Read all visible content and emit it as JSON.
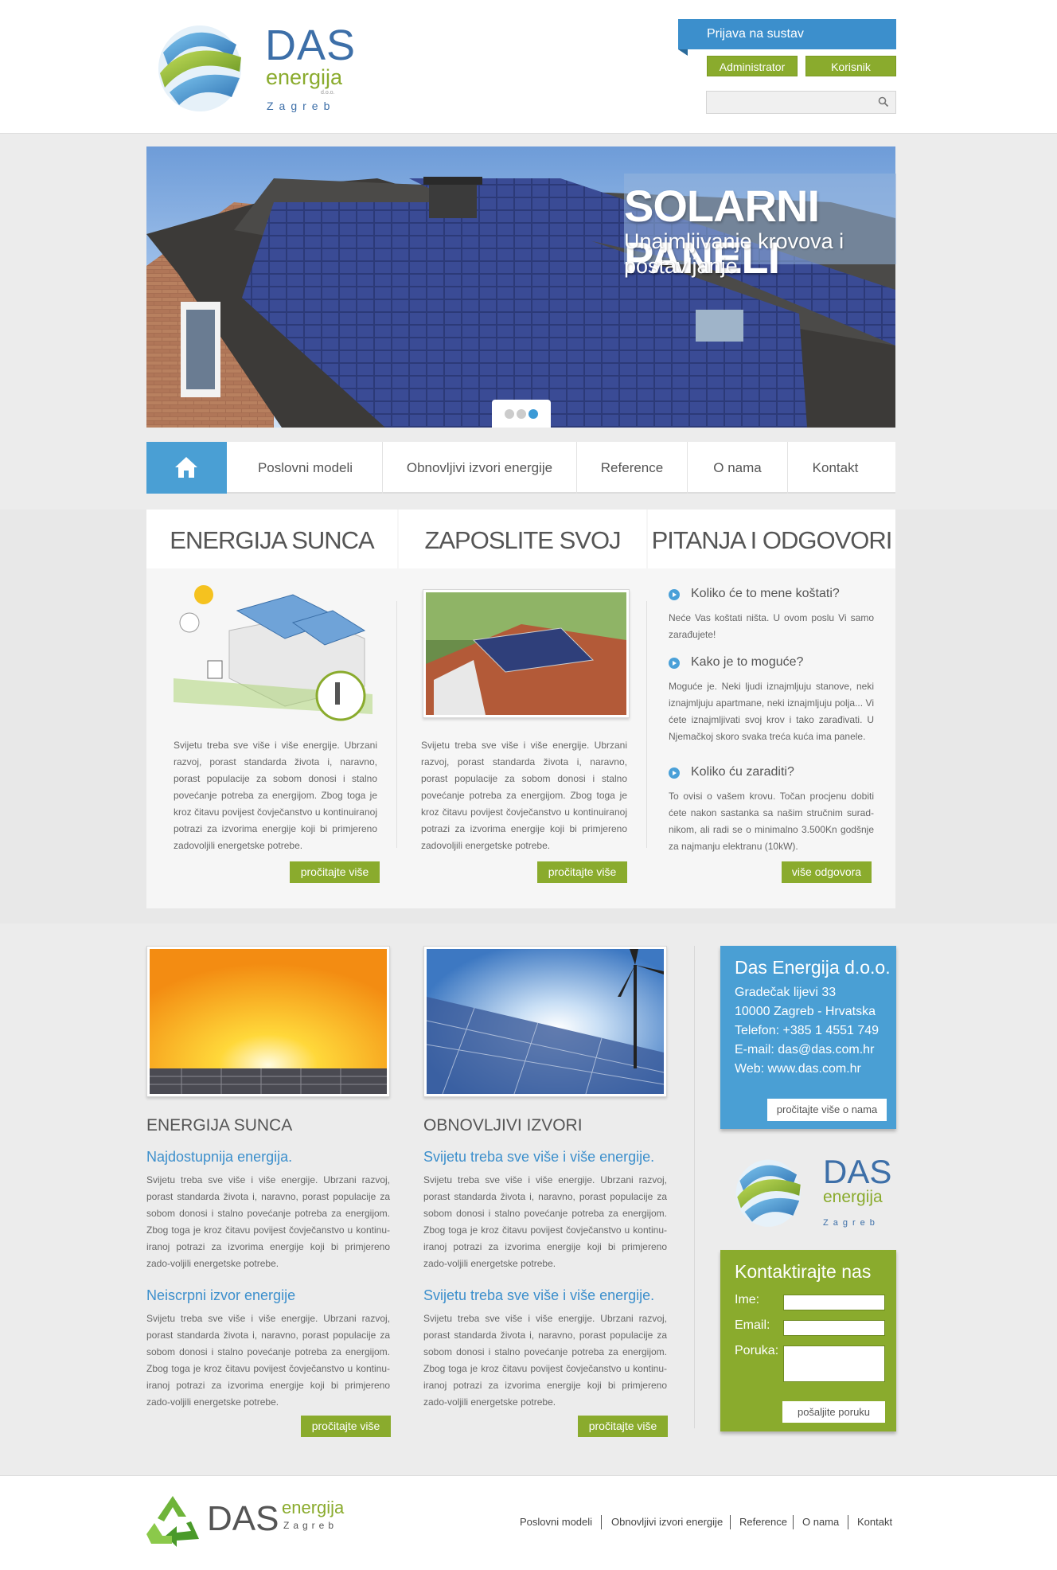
{
  "brand": {
    "name": "DAS",
    "sub": "energija",
    "suffix": "d.o.o.",
    "city": "Zagreb",
    "colors": {
      "blue": "#3c8fcc",
      "green": "#8aab2d"
    }
  },
  "login": {
    "tab": "Prijava na sustav",
    "admin_label": "Administrator",
    "user_label": "Korisnik",
    "search_placeholder": ""
  },
  "hero": {
    "title": "SOLARNI PANELI",
    "subtitle": "Unajmljivanje krovova i postavljanje",
    "active_slide": 3,
    "slide_count": 3
  },
  "nav": {
    "items": [
      "Poslovni modeli",
      "Obnovljivi izvori energije",
      "Reference",
      "O nama",
      "Kontakt"
    ]
  },
  "columns": [
    {
      "title": "ENERGIJA SUNCA",
      "text": "Svijetu treba sve više i više energije. Ubrzani razvoj, porast standarda života i, naravno, porast populacije za sobom donosi i stalno povećanje potreba za energijom. Zbog toga je kroz čitavu povijest čovječanstvo u kontinuiranoj potrazi za izvorima energije koji bi primjereno zadovoljili energetske potrebe.",
      "button": "pročitajte više"
    },
    {
      "title": "ZAPOSLITE SVOJ KROV",
      "text": "Svijetu treba sve više i više energije. Ubrzani razvoj, porast standarda života i, naravno, porast populacije za sobom donosi i stalno povećanje potreba za energijom. Zbog toga je kroz čitavu povijest čovječanstvo u kontinuiranoj potrazi za izvorima energije koji bi primjereno zadovoljili energetske potrebe.",
      "button": "pročitajte više"
    },
    {
      "title": "PITANJA I ODGOVORI",
      "button": "više odgovora",
      "faq": [
        {
          "q": "Koliko će to mene koštati?",
          "a": "Neće Vas koštati ništa. U ovom poslu Vi samo zarađujete!"
        },
        {
          "q": "Kako je to moguće?",
          "a": "Moguće je. Neki ljudi iznajmljuju stanove, neki iznajmljuju apartmane, neki iznajmljuju polja... Vi ćete iznajmljivati svoj krov i tako zarađivati. U Njemačkoj skoro svaka treća kuća ima panele."
        },
        {
          "q": "Koliko ću zaraditi?",
          "a": "To ovisi o vašem krovu. Točan procjenu dobiti ćete nakon sastanka sa našim stručnim surad-nikom, ali radi se o minimalno 3.500Kn godšnje za najmanju elektranu (10kW)."
        }
      ]
    }
  ],
  "articles": [
    {
      "title": "ENERGIJA SUNCA",
      "sub1": "Najdostupnija energija.",
      "text1": "Svijetu treba sve više i više energije. Ubrzani razvoj, porast standarda života i, naravno, porast populacije za sobom donosi i stalno povećanje potreba za energijom. Zbog toga je kroz čitavu povijest čovječanstvo u kontinu-iranoj potrazi za izvorima energije koji bi primjereno zado-voljili energetske potrebe.",
      "sub2": "Neiscrpni izvor energije",
      "text2": "Svijetu treba sve više i više energije. Ubrzani razvoj, porast standarda života i, naravno, porast populacije za sobom donosi i stalno povećanje potreba za energijom. Zbog toga je kroz čitavu povijest čovječanstvo u kontinu-iranoj potrazi za izvorima energije koji bi primjereno zado-voljili energetske potrebe.",
      "button": "pročitajte više"
    },
    {
      "title": "OBNOVLJIVI IZVORI",
      "sub1": "Svijetu treba sve više i više energije.",
      "text1": "Svijetu treba sve više i više energije. Ubrzani razvoj, porast standarda života i, naravno, porast populacije za sobom donosi i stalno povećanje potreba za energijom. Zbog toga je kroz čitavu povijest čovječanstvo u kontinu-iranoj potrazi za izvorima energije koji bi primjereno zado-voljili energetske potrebe.",
      "sub2": "Svijetu treba sve više i više energije.",
      "text2": "Svijetu treba sve više i više energije. Ubrzani razvoj, porast standarda života i, naravno, porast populacije za sobom donosi i stalno povećanje potreba za energijom. Zbog toga je kroz čitavu povijest čovječanstvo u kontinu-iranoj potrazi za izvorima energije koji bi primjereno zado-voljili energetske potrebe.",
      "button": "pročitajte više"
    }
  ],
  "contact": {
    "title": "Das Energija d.o.o.",
    "lines": [
      "Gradečak lijevi 33",
      "10000 Zagreb  -  Hrvatska",
      "Telefon: +385 1 4551 749",
      "E-mail: das@das.com.hr",
      "Web: www.das.com.hr"
    ],
    "button": "pročitajte više o nama"
  },
  "form": {
    "title": "Kontaktirajte nas",
    "name_label": "Ime:",
    "email_label": "Email:",
    "message_label": "Poruka:",
    "button": "pošaljite poruku"
  },
  "footer": {
    "brand_das": "DAS",
    "brand_sub": "energija",
    "brand_city": "Zagreb",
    "links": [
      "Poslovni modeli",
      "Obnovljivi izvori energije",
      "Reference",
      "O nama",
      "Kontakt"
    ]
  }
}
